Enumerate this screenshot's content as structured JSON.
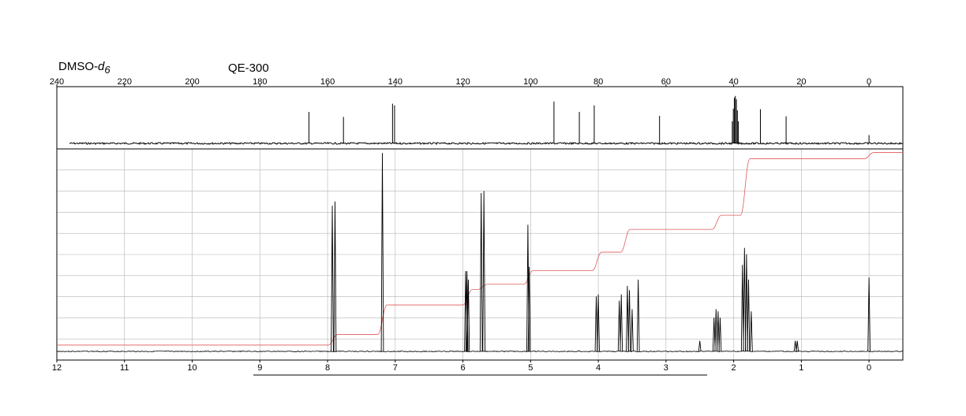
{
  "labels": {
    "solvent_prefix": "DMSO-",
    "solvent_italic": "d",
    "solvent_subscript": "6",
    "instrument": "QE-300"
  },
  "colors": {
    "spectrum": "#000000",
    "integral": "#e05a5a",
    "grid": "#b4b4b4",
    "background": "#ffffff"
  },
  "chart_data": [
    {
      "type": "line",
      "title": "",
      "xlabel": "",
      "ylabel": "",
      "x_axis": "ppm, decreasing left to right",
      "xlim": [
        240,
        -10
      ],
      "xticks": [
        240,
        220,
        200,
        180,
        160,
        140,
        120,
        100,
        80,
        60,
        40,
        20,
        0
      ],
      "grid": false,
      "peaks": [
        {
          "ppm": 165.5,
          "height": 0.57
        },
        {
          "ppm": 155.3,
          "height": 0.48
        },
        {
          "ppm": 140.8,
          "height": 0.72
        },
        {
          "ppm": 140.2,
          "height": 0.69
        },
        {
          "ppm": 93.1,
          "height": 0.76
        },
        {
          "ppm": 85.6,
          "height": 0.57
        },
        {
          "ppm": 81.2,
          "height": 0.69
        },
        {
          "ppm": 61.9,
          "height": 0.5
        },
        {
          "ppm": 40.4,
          "height": 0.4
        },
        {
          "ppm": 40.1,
          "height": 0.63
        },
        {
          "ppm": 39.8,
          "height": 0.83
        },
        {
          "ppm": 39.5,
          "height": 0.86
        },
        {
          "ppm": 39.2,
          "height": 0.8
        },
        {
          "ppm": 38.9,
          "height": 0.6
        },
        {
          "ppm": 38.6,
          "height": 0.4
        },
        {
          "ppm": 32.1,
          "height": 0.62
        },
        {
          "ppm": 24.5,
          "height": 0.49
        },
        {
          "ppm": 0.0,
          "height": 0.15
        }
      ]
    },
    {
      "type": "line",
      "title": "",
      "xlabel": "",
      "ylabel": "",
      "x_axis": "ppm, decreasing left to right",
      "xlim": [
        12,
        -0.5
      ],
      "xticks": [
        12,
        11,
        10,
        9,
        8,
        7,
        6,
        5,
        4,
        3,
        2,
        1,
        0
      ],
      "ylim": [
        0,
        1
      ],
      "grid": true,
      "peaks": [
        {
          "ppm": 7.93,
          "height": 0.69
        },
        {
          "ppm": 7.89,
          "height": 0.71
        },
        {
          "ppm": 7.19,
          "height": 0.94
        },
        {
          "ppm": 5.96,
          "height": 0.38
        },
        {
          "ppm": 5.94,
          "height": 0.38
        },
        {
          "ppm": 5.92,
          "height": 0.34
        },
        {
          "ppm": 5.73,
          "height": 0.75
        },
        {
          "ppm": 5.69,
          "height": 0.76
        },
        {
          "ppm": 5.04,
          "height": 0.6
        },
        {
          "ppm": 5.02,
          "height": 0.4
        },
        {
          "ppm": 4.03,
          "height": 0.26
        },
        {
          "ppm": 4.0,
          "height": 0.27
        },
        {
          "ppm": 3.69,
          "height": 0.24
        },
        {
          "ppm": 3.66,
          "height": 0.27
        },
        {
          "ppm": 3.57,
          "height": 0.31
        },
        {
          "ppm": 3.54,
          "height": 0.29
        },
        {
          "ppm": 3.5,
          "height": 0.2
        },
        {
          "ppm": 3.41,
          "height": 0.34
        },
        {
          "ppm": 2.5,
          "height": 0.05
        },
        {
          "ppm": 2.29,
          "height": 0.16
        },
        {
          "ppm": 2.26,
          "height": 0.2
        },
        {
          "ppm": 2.23,
          "height": 0.19
        },
        {
          "ppm": 2.2,
          "height": 0.16
        },
        {
          "ppm": 1.87,
          "height": 0.41
        },
        {
          "ppm": 1.84,
          "height": 0.49
        },
        {
          "ppm": 1.81,
          "height": 0.46
        },
        {
          "ppm": 1.78,
          "height": 0.34
        },
        {
          "ppm": 1.74,
          "height": 0.19
        },
        {
          "ppm": 1.09,
          "height": 0.05
        },
        {
          "ppm": 1.06,
          "height": 0.05
        },
        {
          "ppm": 0.0,
          "height": 0.35
        }
      ],
      "integral_steps": [
        {
          "ppm": 7.92,
          "level": 0.08
        },
        {
          "ppm": 7.19,
          "level": 0.22
        },
        {
          "ppm": 5.93,
          "level": 0.293
        },
        {
          "ppm": 5.71,
          "level": 0.318
        },
        {
          "ppm": 5.03,
          "level": 0.383
        },
        {
          "ppm": 4.02,
          "level": 0.47
        },
        {
          "ppm": 3.6,
          "level": 0.578
        },
        {
          "ppm": 2.25,
          "level": 0.645
        },
        {
          "ppm": 1.83,
          "level": 0.912
        },
        {
          "ppm": 0.0,
          "level": 0.942
        }
      ]
    }
  ]
}
